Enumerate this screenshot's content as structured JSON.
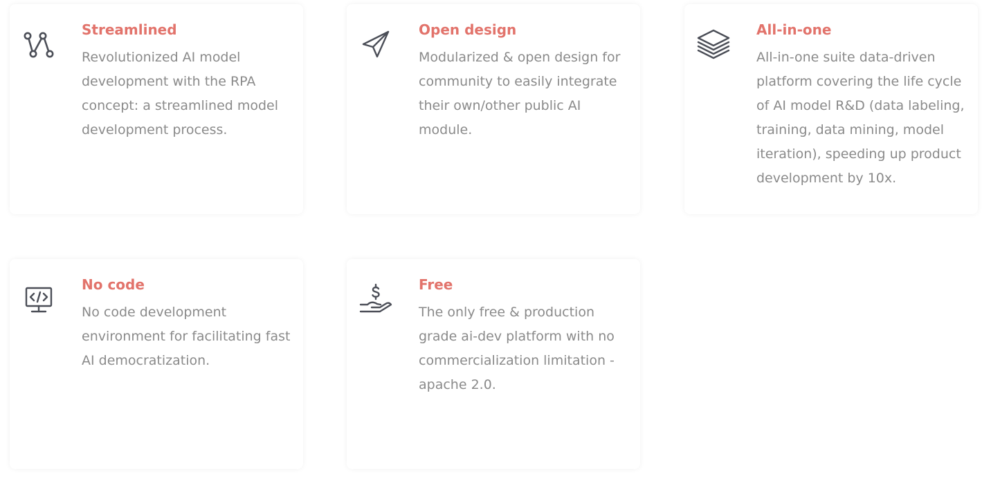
{
  "theme": {
    "title_color": "#e2736b",
    "text_color": "#8a8a8a",
    "icon_color": "#4b4e57"
  },
  "features": [
    {
      "icon": "streamline-nodes-icon",
      "title": "Streamlined",
      "description": "Revolutionized AI model development with the RPA concept: a streamlined model development process."
    },
    {
      "icon": "paper-plane-icon",
      "title": "Open design",
      "description": "Modularized & open design for community to easily integrate their own/other public AI module."
    },
    {
      "icon": "layers-icon",
      "title": "All-in-one",
      "description": "All-in-one suite data-driven platform covering the life cycle of AI model R&D (data labeling, training, data mining, model iteration), speeding up product development by 10x."
    },
    {
      "icon": "code-monitor-icon",
      "title": "No code",
      "description": "No code development environment for facilitating fast AI democratization."
    },
    {
      "icon": "hand-dollar-icon",
      "title": "Free",
      "description": "The only free & production grade ai-dev platform with no commercialization limitation - apache 2.0."
    }
  ]
}
